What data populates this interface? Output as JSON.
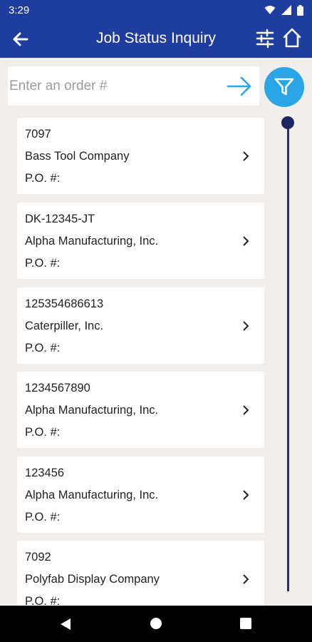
{
  "status_bar": {
    "time": "3:29"
  },
  "app_bar": {
    "title": "Job Status Inquiry"
  },
  "search": {
    "placeholder": "Enter an order #",
    "value": ""
  },
  "jobs": [
    {
      "order": "7097",
      "company": "Bass Tool Company",
      "po_label": "P.O. #:"
    },
    {
      "order": "DK-12345-JT",
      "company": "Alpha Manufacturing, Inc.",
      "po_label": "P.O. #:"
    },
    {
      "order": "125354686613",
      "company": "Caterpiller, Inc.",
      "po_label": "P.O. #:"
    },
    {
      "order": "1234567890",
      "company": "Alpha Manufacturing, Inc.",
      "po_label": "P.O. #:"
    },
    {
      "order": "123456",
      "company": "Alpha Manufacturing, Inc.",
      "po_label": "P.O. #:"
    },
    {
      "order": "7092",
      "company": "Polyfab Display Company",
      "po_label": "P.O. #:"
    }
  ],
  "colors": {
    "app_bar": "#1f3d9e",
    "accent": "#2aa6e6",
    "background": "#f1eeec"
  },
  "icons": [
    "back-arrow-icon",
    "sliders-icon",
    "home-icon",
    "arrow-right-icon",
    "filter-icon",
    "chevron-right-icon"
  ]
}
